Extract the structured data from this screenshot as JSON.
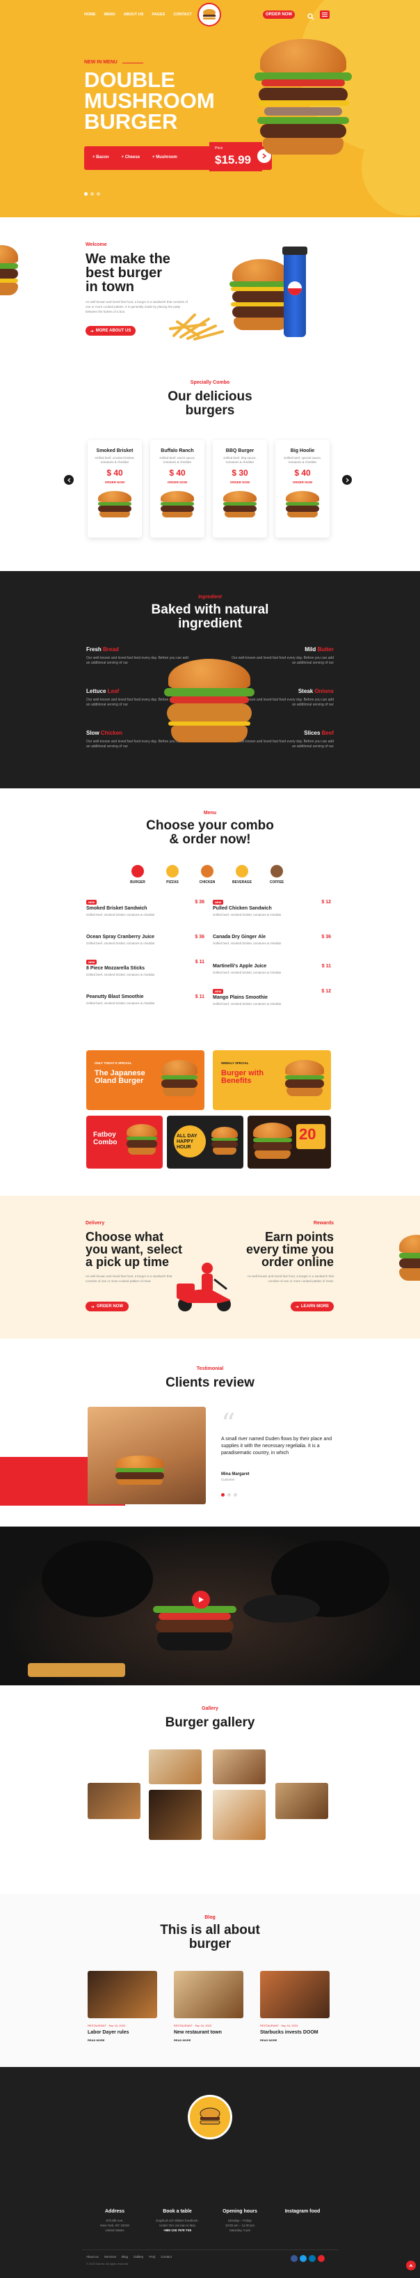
{
  "header": {
    "nav": [
      "HOME",
      "MENU",
      "ABOUT US",
      "PAGES",
      "CONTACT"
    ],
    "cta": "ORDER NOW"
  },
  "hero": {
    "tag": "NEW IN MENU",
    "title_lines": [
      "DOUBLE",
      "MUSHROOM",
      "BURGER"
    ],
    "options": [
      "Bacon",
      "Cheese",
      "Mushroom"
    ],
    "price_label": "Price",
    "price": "$15.99"
  },
  "about": {
    "tag": "Welcome",
    "title_lines": [
      "We make the",
      "best burger",
      "in town"
    ],
    "text": "As well-known and loved fast food, a burger is a sandwich that consists of one or more cooked patties. It is generally made by placing the patty between the halves of a bun.",
    "button": "MORE ABOUT US"
  },
  "combos": {
    "tag": "Specially Combo",
    "title_lines": [
      "Our delicious",
      "burgers"
    ],
    "cards": [
      {
        "name": "Smoked Brisket",
        "desc": "Grilled beef, smoked brisket, tomatoes & cheddar",
        "price": "$ 40",
        "cta": "ORDER NOW"
      },
      {
        "name": "Buffalo Ranch",
        "desc": "Grilled beef, ranch sauce, tomatoes & cheddar",
        "price": "$ 40",
        "cta": "ORDER NOW"
      },
      {
        "name": "BBQ Burger",
        "desc": "Grilled beef, bbq sauce, tomatoes & cheddar",
        "price": "$ 30",
        "cta": "ORDER NOW"
      },
      {
        "name": "Big Hoolie",
        "desc": "Grilled beef, special sauce, tomatoes & cheddar",
        "price": "$ 40",
        "cta": "ORDER NOW"
      }
    ]
  },
  "ingredients": {
    "tag": "Ingredient",
    "title_lines": [
      "Baked with natural",
      "ingredient"
    ],
    "left": [
      {
        "a": "Fresh",
        "b": "Bread",
        "desc": "Our well-known and loved fast food every day. Before you can add an additional serving of our"
      },
      {
        "a": "Lettuce",
        "b": "Leaf",
        "desc": "Our well-known and loved fast food every day. Before you can add an additional serving of our"
      },
      {
        "a": "Slow",
        "b": "Chicken",
        "desc": "Our well-known and loved fast food every day. Before you can add an additional serving of our"
      }
    ],
    "right": [
      {
        "a": "Mild",
        "b": "Butter",
        "desc": "Our well-known and loved fast food every day. Before you can add an additional serving of our"
      },
      {
        "a": "Steak",
        "b": "Onions",
        "desc": "Our well-known and loved fast food every day. Before you can add an additional serving of our"
      },
      {
        "a": "Slices",
        "b": "Beef",
        "desc": "Our well-known and loved fast food every day. Before you can add an additional serving of our"
      }
    ]
  },
  "menu": {
    "tag": "Menu",
    "title_lines": [
      "Choose your combo",
      "& order now!"
    ],
    "categories": [
      "BURGER",
      "PIZZAS",
      "CHICKEN",
      "BEVERAGE",
      "COFFEE"
    ],
    "items_left": [
      {
        "badge": "NEW",
        "name": "Smoked Brisket Sandwich",
        "price": "$ 36",
        "desc": "Grilled beef, smoked brisket, tomatoes & cheddar"
      },
      {
        "badge": "",
        "name": "Ocean Spray Cranberry Juice",
        "price": "$ 36",
        "desc": "Grilled beef, smoked brisket, tomatoes & cheddar"
      },
      {
        "badge": "NEW",
        "name": "8 Piece Mozzarella Sticks",
        "price": "$ 11",
        "desc": "Grilled beef, smoked brisket, tomatoes & cheddar"
      },
      {
        "badge": "",
        "name": "Peanutty Blast Smoothie",
        "price": "$ 11",
        "desc": "Grilled beef, smoked brisket, tomatoes & cheddar"
      }
    ],
    "items_right": [
      {
        "badge": "NEW",
        "name": "Pulled Chicken Sandwich",
        "price": "$ 12",
        "desc": "Grilled beef, smoked brisket, tomatoes & cheddar"
      },
      {
        "badge": "",
        "name": "Canada Dry Ginger Ale",
        "price": "$ 36",
        "desc": "Grilled beef, smoked brisket, tomatoes & cheddar"
      },
      {
        "badge": "",
        "name": "Martinelli's Apple Juice",
        "price": "$ 11",
        "desc": "Grilled beef, smoked brisket, tomatoes & cheddar"
      },
      {
        "badge": "NEW",
        "name": "Mango Plains Smoothie",
        "price": "$ 12",
        "desc": "Grilled beef, smoked brisket, tomatoes & cheddar"
      }
    ],
    "banners": {
      "b1_tag": "ONLY TODAY'S SPECIAL",
      "b1_title": "The Japanese Oland Burger",
      "b2_tag": "WEEKLY SPECIAL",
      "b2_title": "Burger with Benefits",
      "b3_title": "Fatboy Combo",
      "b4_title": "ALL DAY HAPPY HOUR",
      "b5_title": "20"
    }
  },
  "delivery": {
    "left_tag": "Delivery",
    "left_title": [
      "Choose what",
      "you want, select",
      "a pick up time"
    ],
    "left_text": "As well-known and loved fast food, a burger is a sandwich that consists of one or more cooked patties of meat.",
    "left_btn": "ORDER NOW",
    "right_tag": "Rewards",
    "right_title": [
      "Earn points",
      "every time you",
      "order online"
    ],
    "right_text": "As well-known and loved fast food, a burger is a sandwich that consists of one or more cooked patties of meat.",
    "right_btn": "LEARN MORE"
  },
  "testimonial": {
    "tag": "Testimonial",
    "title": "Clients review",
    "quote": "A small river named Duden flows by their place and supplies it with the necessary regelialia. It is a paradisematic country, in which",
    "author": "Mina Margaret",
    "role": "Customer"
  },
  "gallery": {
    "tag": "Gallery",
    "title": "Burger gallery"
  },
  "blog": {
    "tag": "Blog",
    "title_lines": [
      "This is all about",
      "burger"
    ],
    "posts": [
      {
        "meta_a": "RESTAURANT",
        "meta_b": "Sep 16, 2023",
        "title": "Labor Dayer rules",
        "more": "READ MORE"
      },
      {
        "meta_a": "RESTAURANT",
        "meta_b": "Sep 16, 2023",
        "title": "New restaurant town",
        "more": "READ MORE"
      },
      {
        "meta_a": "RESTAURANT",
        "meta_b": "Sep 16, 2023",
        "title": "Starbucks invests DOOM",
        "more": "READ MORE"
      }
    ]
  },
  "footer": {
    "cols": [
      {
        "h": "Address",
        "l1": "570 8th Ave,",
        "l2": "New York, NY 10018",
        "l3": "United States"
      },
      {
        "h": "Book a table",
        "l1": "Dogfood och Sliders foodtruck.",
        "l2": "Under Om oss kan ni läsa",
        "l3": "+880 1X6 7979 TX9"
      },
      {
        "h": "Opening hours",
        "l1": "Monday – Friday",
        "l2": "10:00 am – 11:00 pm",
        "l3": "Saturday: 9 pm"
      },
      {
        "h": "Instagram food",
        "l1": "",
        "l2": "",
        "l3": ""
      }
    ],
    "links": [
      "About us",
      "Services",
      "Blog",
      "Gallery",
      "FAQ",
      "Contact"
    ],
    "copyright": "© 2023 Gamer. All rights reserved"
  }
}
